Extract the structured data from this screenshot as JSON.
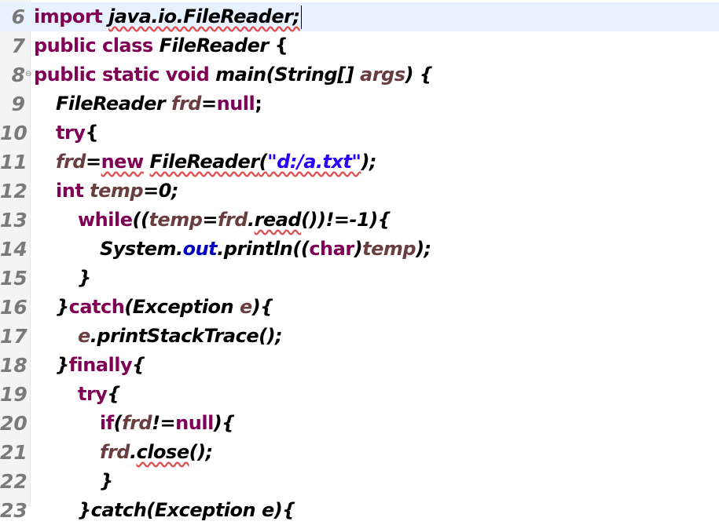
{
  "editor": {
    "line_numbers": [
      "6",
      "7",
      "8",
      "9",
      "10",
      "11",
      "12",
      "13",
      "14",
      "15",
      "16",
      "17",
      "18",
      "19",
      "20",
      "21",
      "22",
      "23"
    ],
    "lines": {
      "l6": {
        "kw": "import",
        "pkg": "java.io.FileReader;"
      },
      "l7": {
        "kw": "public class",
        "name": "FileReader",
        "brace": " {"
      },
      "l8": {
        "kw": "public static void",
        "m": "main",
        "p1": "(String[] ",
        "arg": "args",
        "p2": ") {"
      },
      "l9": {
        "t": "FileReader ",
        "v": "frd",
        "eq": "=",
        "kw": "null",
        "semi": ";"
      },
      "l10": {
        "kw": "try",
        "b": "{"
      },
      "l11": {
        "v": "frd",
        "eq": "=",
        "kw": "new",
        "sp": " ",
        "cls": "FileReader",
        "o": "(",
        "s": "\"d:/a.txt\"",
        "c": ");"
      },
      "l12": {
        "kw": "int",
        "sp": " ",
        "v": "temp",
        "r": "=0;"
      },
      "l13": {
        "kw": "while",
        "o": "((",
        "v1": "temp",
        "eq": "=",
        "v2": "frd",
        "dot": ".",
        "m": "read",
        "r": "())!=-1){"
      },
      "l14": {
        "sys": "System.",
        "f": "out",
        "m": ".println((",
        "kw": "char",
        "cp": ")",
        "v": "temp",
        "c": ");"
      },
      "l15": {
        "t": "}"
      },
      "l16": {
        "t1": "}",
        "kw": "catch",
        "o": "(Exception ",
        "v": "e",
        "c": "){"
      },
      "l17": {
        "v": "e",
        "m": ".printStackTrace();"
      },
      "l18": {
        "t1": "}",
        "kw": "finally",
        "b": "{"
      },
      "l19": {
        "kw": "try",
        "b": "{"
      },
      "l20": {
        "kw1": "if",
        "o": "(",
        "v": "frd",
        "ne": "!=",
        "kw2": "null",
        "c": "){"
      },
      "l21": {
        "v": "frd",
        "dot": ".",
        "m": "close",
        "c": "();"
      },
      "l22": {
        "t": "}"
      },
      "l23": {
        "t": "}catch(Exception e){"
      }
    }
  }
}
